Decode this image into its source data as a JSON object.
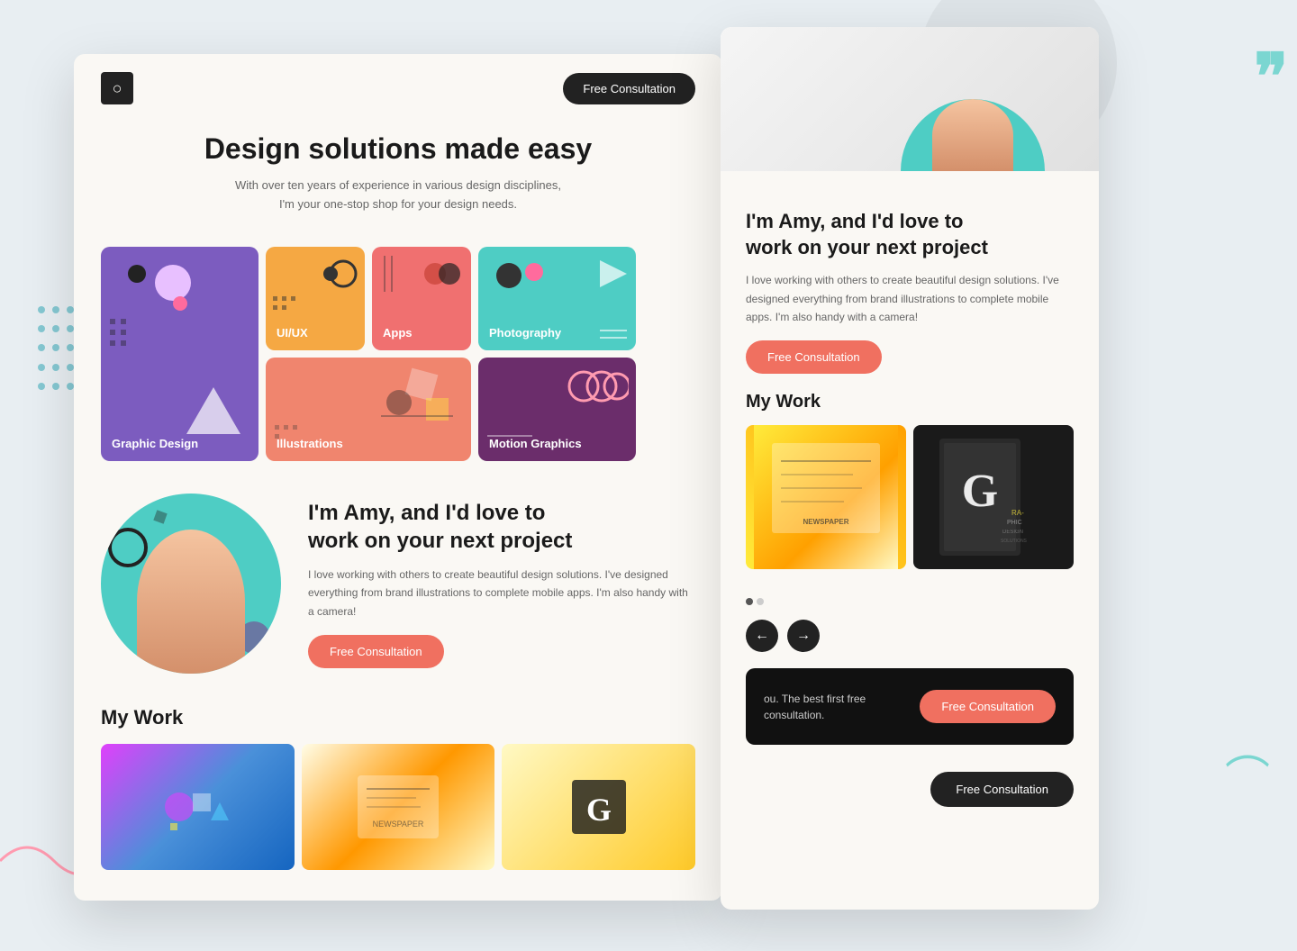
{
  "background": {
    "color": "#e8eef2"
  },
  "card_main": {
    "header": {
      "logo_symbol": "○",
      "btn_label": "Free Consultation"
    },
    "hero": {
      "title": "Design solutions made easy",
      "subtitle": "With over ten years of experience in various design disciplines, I'm your one-stop shop for your design needs."
    },
    "services": [
      {
        "id": "graphic-design",
        "label": "Graphic Design",
        "color": "#7c5cbf"
      },
      {
        "id": "ui-ux",
        "label": "UI/UX",
        "color": "#f5a843"
      },
      {
        "id": "apps",
        "label": "Apps",
        "color": "#f07070"
      },
      {
        "id": "photography",
        "label": "Photography",
        "color": "#4ecdc4"
      },
      {
        "id": "illustrations",
        "label": "Illustrations",
        "color": "#f0856e"
      },
      {
        "id": "motion-graphics",
        "label": "Motion Graphics",
        "color": "#6b2d6b"
      }
    ],
    "about": {
      "heading_line1": "I'm Amy, and I'd love to",
      "heading_line2": "work on your next project",
      "body": "I love working with others to create beautiful design solutions. I've designed everything from brand illustrations to complete mobile apps. I'm also handy with a camera!",
      "btn_label": "Free Consultation"
    },
    "my_work": {
      "title": "My Work"
    }
  },
  "card_back": {
    "about": {
      "heading_line1": "I'm Amy, and I'd love to",
      "heading_line2": "work on your next project",
      "body": "I love working with others to create beautiful design solutions. I've designed everything from brand illustrations to complete mobile apps. I'm also handy with a camera!",
      "btn_label": "Free Consultation"
    },
    "my_work": {
      "title": "My Work"
    },
    "nav": {
      "prev_label": "←",
      "next_label": "→"
    },
    "cta": {
      "text": "ou. The best first free consultation.",
      "btn_label": "Free Consultation"
    },
    "footer": {
      "btn_label": "Free Consultation"
    }
  }
}
